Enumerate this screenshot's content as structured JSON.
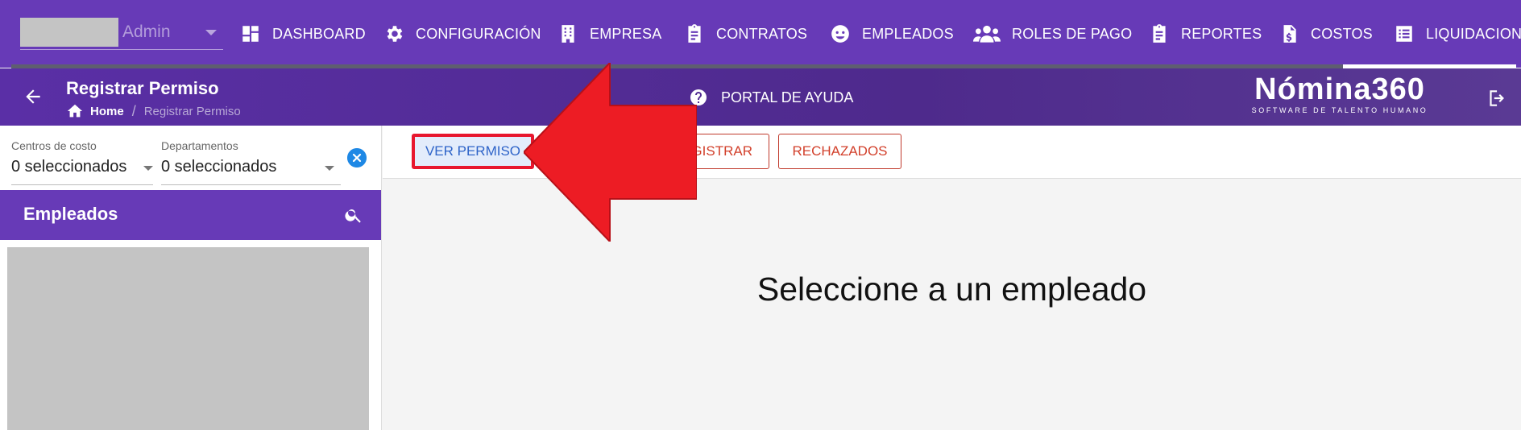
{
  "user": {
    "name": "Admin"
  },
  "nav": {
    "items": [
      {
        "label": "DASHBOARD",
        "icon": "dashboard-icon"
      },
      {
        "label": "CONFIGURACIÓN",
        "icon": "gear-icon"
      },
      {
        "label": "EMPRESA",
        "icon": "building-icon"
      },
      {
        "label": "CONTRATOS",
        "icon": "clipboard-icon"
      },
      {
        "label": "EMPLEADOS",
        "icon": "face-icon"
      },
      {
        "label": "ROLES DE PAGO",
        "icon": "people-icon"
      },
      {
        "label": "REPORTES",
        "icon": "clipboard-icon"
      },
      {
        "label": "COSTOS",
        "icon": "dollar-file-icon"
      },
      {
        "label": "LIQUIDACIONES",
        "icon": "list-icon"
      }
    ]
  },
  "header": {
    "title": "Registrar Permiso",
    "breadcrumb": {
      "home": "Home",
      "separator": "/",
      "current": "Registrar Permiso"
    },
    "help_label": "PORTAL DE AYUDA",
    "brand_name": "Nómina360",
    "brand_tagline": "SOFTWARE DE TALENTO HUMANO"
  },
  "filters": {
    "cost_centers": {
      "label": "Centros de costo",
      "value": "0 seleccionados"
    },
    "departments": {
      "label": "Departamentos",
      "value": "0 seleccionados"
    }
  },
  "employees": {
    "title": "Empleados"
  },
  "tabs": {
    "view": "VER PERMISO",
    "register": "REGISTRAR",
    "rejected": "RECHAZADOS"
  },
  "main": {
    "empty_message": "Seleccione a un empleado"
  },
  "colors": {
    "primary": "#673ab7",
    "danger": "#d23f2a",
    "highlight": "#e8172e",
    "active_tab_text": "#2d63c8"
  }
}
